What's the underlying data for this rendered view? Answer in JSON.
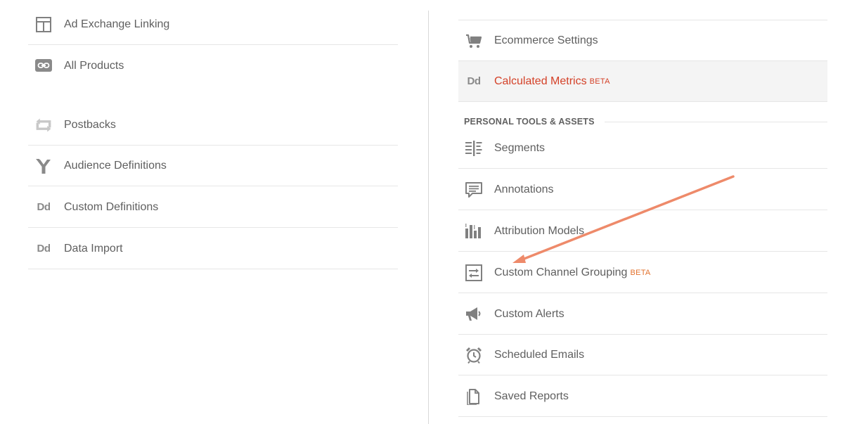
{
  "left_menu": {
    "items": [
      {
        "label": "Ad Exchange Linking",
        "icon": "ad-exchange-icon"
      },
      {
        "label": "All Products",
        "icon": "link-icon"
      },
      {
        "label": "Postbacks",
        "icon": "postback-arrows-icon"
      },
      {
        "label": "Audience Definitions",
        "icon": "audience-fork-icon"
      },
      {
        "label": "Custom Definitions",
        "icon": "dd-icon",
        "icon_text": "Dd"
      },
      {
        "label": "Data Import",
        "icon": "dd-icon",
        "icon_text": "Dd"
      }
    ]
  },
  "right_menu": {
    "items": [
      {
        "label": "Ecommerce Settings",
        "icon": "cart-icon"
      },
      {
        "label": "Calculated Metrics",
        "badge": "BETA",
        "icon": "dd-icon",
        "icon_text": "Dd",
        "active": true
      }
    ],
    "section_title": "PERSONAL TOOLS & ASSETS",
    "personal_items": [
      {
        "label": "Segments",
        "icon": "segments-icon"
      },
      {
        "label": "Annotations",
        "icon": "annotation-icon"
      },
      {
        "label": "Attribution Models",
        "icon": "bar-chart-icon"
      },
      {
        "label": "Custom Channel Grouping",
        "badge": "BETA",
        "icon": "channel-grouping-icon"
      },
      {
        "label": "Custom Alerts",
        "icon": "megaphone-icon"
      },
      {
        "label": "Scheduled Emails",
        "icon": "alarm-clock-icon"
      },
      {
        "label": "Saved Reports",
        "icon": "document-icon"
      }
    ]
  },
  "colors": {
    "active_label": "#d44128",
    "beta": "#e2712d",
    "annotation_arrow": "#ee8a6a",
    "text": "#5f5f5f",
    "icon": "#808080"
  }
}
